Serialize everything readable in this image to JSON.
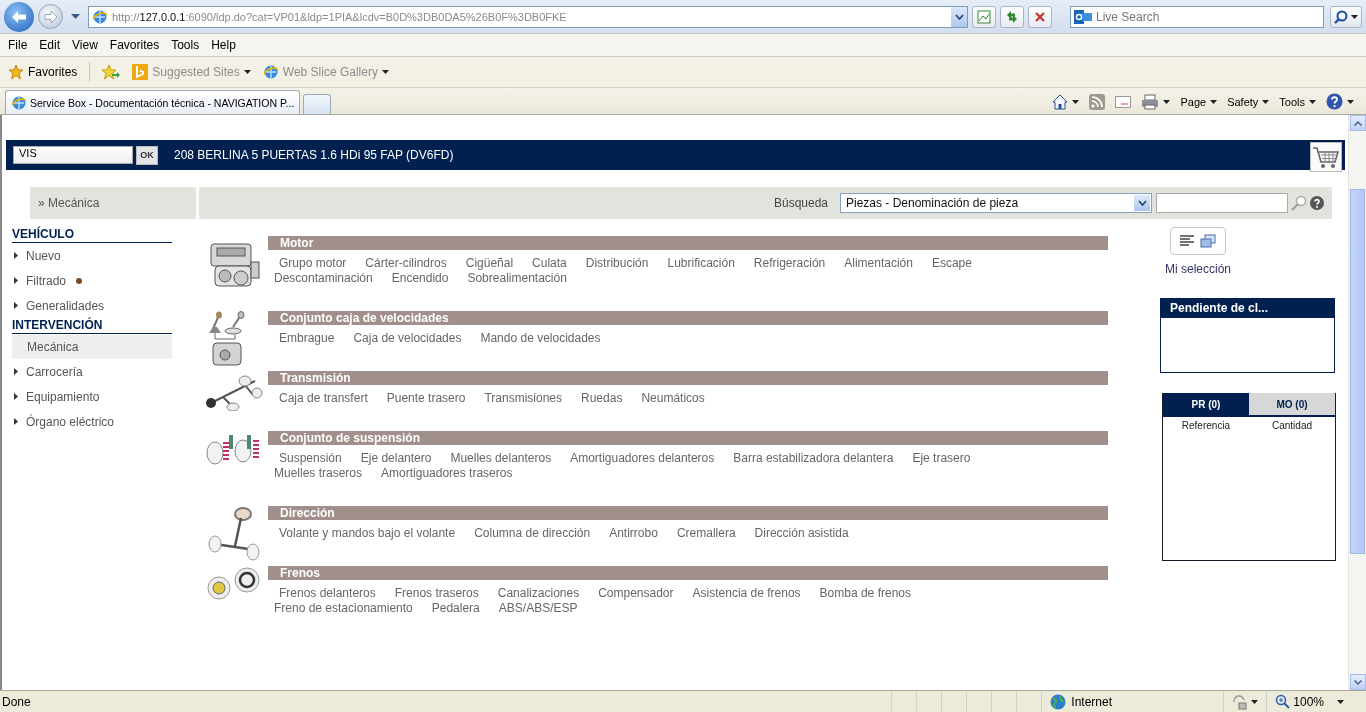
{
  "browser": {
    "address": {
      "scheme": "http://",
      "host": "127.0.0.1",
      "rest": ":6090/ldp.do?cat=VP01&ldp=1PIA&lcdv=B0D%3DB0DA5%26B0F%3DB0FKE"
    },
    "search_placeholder": "Live Search",
    "menu": [
      "File",
      "Edit",
      "View",
      "Favorites",
      "Tools",
      "Help"
    ],
    "favorites": {
      "label": "Favorites",
      "links": [
        "Suggested Sites",
        "Web Slice Gallery"
      ]
    },
    "tabs": [
      {
        "label": "Service Box - Documentación técnica - NAVIGATION P...",
        "selected": true
      }
    ],
    "commands": [
      "Page",
      "Safety",
      "Tools"
    ]
  },
  "page": {
    "header": {
      "vis_value": "VIS",
      "ok": "OK",
      "vehicle": "208 BERLINA 5 PUERTAS 1.6 HDi 95 FAP (DV6FD)"
    },
    "breadcrumb": "» Mecánica",
    "search": {
      "label": "Búsqueda",
      "type": "Piezas - Denominación de pieza"
    },
    "sidebar": [
      {
        "title": "VEHÍCULO",
        "items": [
          {
            "label": "Nuevo",
            "selected": false,
            "indicator": false
          },
          {
            "label": "Filtrado",
            "selected": false,
            "indicator": true
          },
          {
            "label": "Generalidades",
            "selected": false,
            "indicator": false
          }
        ]
      },
      {
        "title": "INTERVENCIÓN",
        "items": [
          {
            "label": "Mecánica",
            "selected": true,
            "indicator": false
          },
          {
            "label": "Carrocería",
            "selected": false,
            "indicator": false
          },
          {
            "label": "Equipamiento",
            "selected": false,
            "indicator": false
          },
          {
            "label": "Órgano eléctrico",
            "selected": false,
            "indicator": false
          }
        ]
      }
    ],
    "categories": [
      {
        "kind": "engine",
        "title": "Motor",
        "lines": [
          [
            "Grupo motor",
            "Cárter-cilindros",
            "Cigüeñal",
            "Culata",
            "Distribución",
            "Lubrificación",
            "Refrigeración",
            "Alimentación",
            "Escape"
          ],
          [
            "Descontaminación",
            "Encendido",
            "Sobrealimentación"
          ]
        ]
      },
      {
        "kind": "gearbox",
        "title": "Conjunto caja de velocidades",
        "lines": [
          [
            "Embrague",
            "Caja de velocidades",
            "Mando de velocidades"
          ]
        ]
      },
      {
        "kind": "transmission",
        "title": "Transmisión",
        "lines": [
          [
            "Caja de transfert",
            "Puente trasero",
            "Transmisiones",
            "Ruedas",
            "Neumáticos"
          ]
        ]
      },
      {
        "kind": "suspension",
        "title": "Conjunto de suspensión",
        "lines": [
          [
            "Suspensión",
            "Eje delantero",
            "Muelles delanteros",
            "Amortiguadores delanteros",
            "Barra estabilizadora delantera",
            "Eje trasero"
          ],
          [
            "Muelles traseros",
            "Amortiguadores traseros"
          ]
        ]
      },
      {
        "kind": "steering",
        "title": "Dirección",
        "lines": [
          [
            "Volante y mandos bajo el volante",
            "Columna de dirección",
            "Antirrobo",
            "Cremallera",
            "Dirección asistida"
          ]
        ]
      },
      {
        "kind": "brakes",
        "title": "Frenos",
        "lines": [
          [
            "Frenos delanteros",
            "Frenos traseros",
            "Canalizaciones",
            "Compensador",
            "Asistencia de frenos",
            "Bomba de frenos"
          ],
          [
            "Freno de estacionamiento",
            "Pedalera",
            "ABS/ABS/ESP"
          ]
        ]
      }
    ],
    "selection_label": "Mi selección",
    "pending_title": "Pendiente de cl...",
    "cart_tabs": [
      {
        "label": "PR (0)",
        "selected": true
      },
      {
        "label": "MO (0)",
        "selected": false
      }
    ],
    "cart_columns": [
      "Referencia",
      "Cantidad"
    ]
  },
  "status": {
    "text": "Done",
    "zone": "Internet",
    "zoom": "100%"
  }
}
